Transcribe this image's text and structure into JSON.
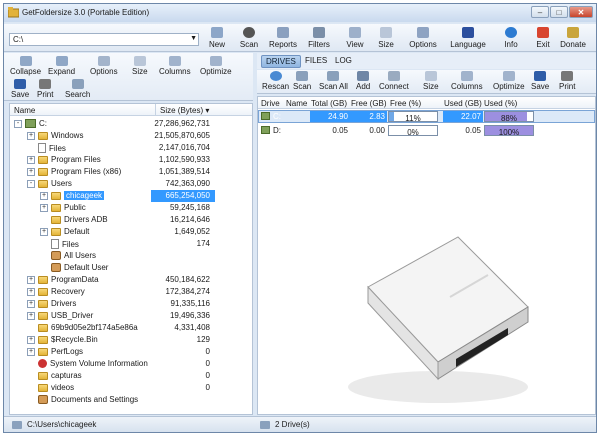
{
  "title": "GetFoldersize 3.0 (Portable Edition)",
  "path": "C:\\",
  "toolbar": [
    "New",
    "Scan",
    "Reports",
    "Filters",
    "View",
    "Size",
    "Options",
    "Language",
    "Info",
    "Exit",
    "Donate"
  ],
  "left_ribbon": {
    "row1": [
      "Collapse",
      "Expand",
      "Options",
      "Size",
      "Columns",
      "Optimize"
    ],
    "row2": [
      "Save",
      "Print",
      "Search"
    ]
  },
  "tabs": [
    "DRIVES",
    "FILES",
    "LOG"
  ],
  "right_ribbon": [
    "Rescan",
    "Scan",
    "Scan All",
    "Add",
    "Connect",
    "Size",
    "Columns",
    "Optimize",
    "Save",
    "Print"
  ],
  "tree_header": {
    "name": "Name",
    "size": "Size (Bytes)"
  },
  "tree": [
    {
      "label": "C:",
      "size": "27,286,962,731",
      "indent": 0,
      "icon": "drive",
      "exp": "-"
    },
    {
      "label": "Windows",
      "size": "21,505,870,605",
      "indent": 1,
      "icon": "folder",
      "exp": "+"
    },
    {
      "label": "Files",
      "size": "2,147,016,704",
      "indent": 1,
      "icon": "file",
      "exp": ""
    },
    {
      "label": "Program Files",
      "size": "1,102,590,933",
      "indent": 1,
      "icon": "folder",
      "exp": "+"
    },
    {
      "label": "Program Files (x86)",
      "size": "1,051,389,514",
      "indent": 1,
      "icon": "folder",
      "exp": "+"
    },
    {
      "label": "Users",
      "size": "742,363,090",
      "indent": 1,
      "icon": "folder",
      "exp": "-"
    },
    {
      "label": "chicageek",
      "size": "665,254,050",
      "indent": 2,
      "icon": "folder",
      "exp": "+",
      "selected": true
    },
    {
      "label": "Public",
      "size": "59,245,168",
      "indent": 2,
      "icon": "folder",
      "exp": "+"
    },
    {
      "label": "Drivers ADB",
      "size": "16,214,646",
      "indent": 2,
      "icon": "folder",
      "exp": ""
    },
    {
      "label": "Default",
      "size": "1,649,052",
      "indent": 2,
      "icon": "folder",
      "exp": "+"
    },
    {
      "label": "Files",
      "size": "174",
      "indent": 2,
      "icon": "file",
      "exp": ""
    },
    {
      "label": "All Users",
      "size": "",
      "indent": 2,
      "icon": "user",
      "exp": ""
    },
    {
      "label": "Default User",
      "size": "",
      "indent": 2,
      "icon": "user",
      "exp": ""
    },
    {
      "label": "ProgramData",
      "size": "450,184,622",
      "indent": 1,
      "icon": "folder",
      "exp": "+"
    },
    {
      "label": "Recovery",
      "size": "172,384,274",
      "indent": 1,
      "icon": "folder",
      "exp": "+"
    },
    {
      "label": "Drivers",
      "size": "91,335,116",
      "indent": 1,
      "icon": "folder",
      "exp": "+"
    },
    {
      "label": "USB_Driver",
      "size": "19,496,336",
      "indent": 1,
      "icon": "folder",
      "exp": "+"
    },
    {
      "label": "69b9d05e2bf174a5e86a",
      "size": "4,331,408",
      "indent": 1,
      "icon": "folder",
      "exp": ""
    },
    {
      "label": "$Recycle.Bin",
      "size": "129",
      "indent": 1,
      "icon": "folder",
      "exp": "+"
    },
    {
      "label": "PerfLogs",
      "size": "0",
      "indent": 1,
      "icon": "folder",
      "exp": "+"
    },
    {
      "label": "System Volume Information",
      "size": "0",
      "indent": 1,
      "icon": "system",
      "exp": ""
    },
    {
      "label": "capturas",
      "size": "0",
      "indent": 1,
      "icon": "folder",
      "exp": ""
    },
    {
      "label": "videos",
      "size": "0",
      "indent": 1,
      "icon": "folder",
      "exp": ""
    },
    {
      "label": "Documents and Settings",
      "size": "",
      "indent": 1,
      "icon": "user",
      "exp": ""
    }
  ],
  "drive_header": [
    "Drive",
    "Name",
    "Total (GB)",
    "Free (GB)",
    "Free (%)",
    "Used (GB)",
    "Used (%)"
  ],
  "drives": [
    {
      "drive": "C:",
      "name": "",
      "total": "24.90",
      "free": "2.83",
      "free_pct": "11%",
      "free_frac": 0.11,
      "used": "22.07",
      "used_pct": "88%",
      "used_frac": 0.88
    },
    {
      "drive": "D:",
      "name": "",
      "total": "0.05",
      "free": "0.00",
      "free_pct": "0%",
      "free_frac": 0.0,
      "used": "0.05",
      "used_pct": "100%",
      "used_frac": 1.0
    }
  ],
  "status": {
    "path": "C:\\Users\\chicageek",
    "drives": "2 Drive(s)"
  },
  "colors": {
    "selection": "#3399ff",
    "used_bar": "#9c8fe0",
    "free_bar": "#6fa8e8"
  }
}
